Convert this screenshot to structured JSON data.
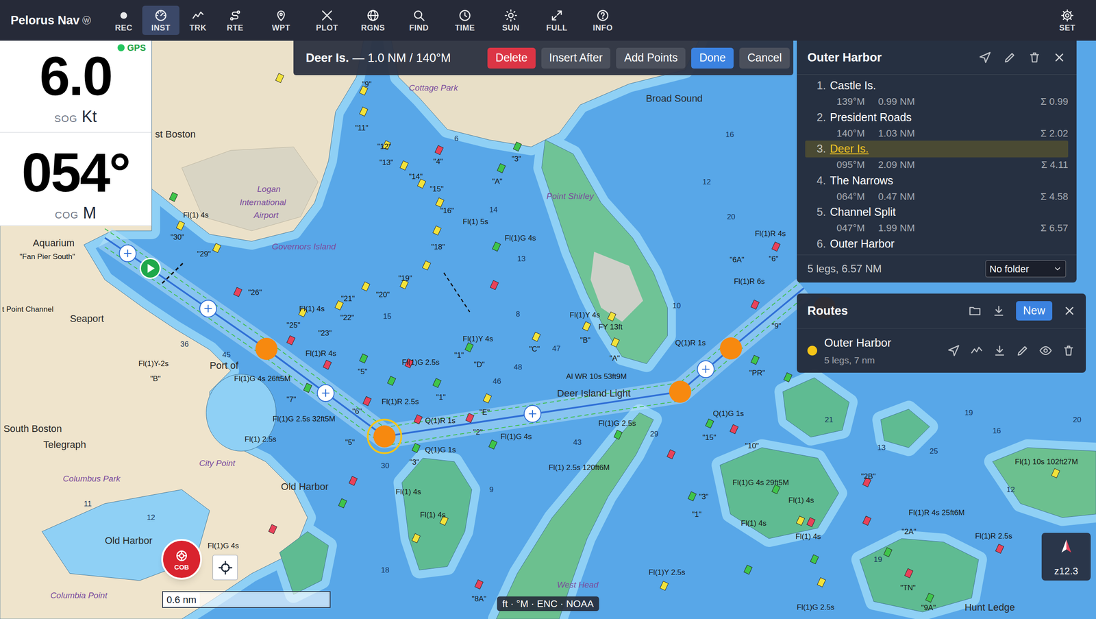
{
  "app": {
    "title": "Pelorus Nav",
    "badge": "ⓦ"
  },
  "toolbar": [
    {
      "label": "REC",
      "selected": false
    },
    {
      "label": "INST",
      "selected": true
    },
    {
      "label": "TRK",
      "selected": false
    },
    {
      "label": "RTE",
      "selected": false
    },
    {
      "label": "WPT",
      "selected": false
    },
    {
      "label": "PLOT",
      "selected": false
    },
    {
      "label": "RGNS",
      "selected": false
    },
    {
      "label": "FIND",
      "selected": false
    },
    {
      "label": "TIME",
      "selected": false
    },
    {
      "label": "SUN",
      "selected": false
    },
    {
      "label": "FULL",
      "selected": false
    },
    {
      "label": "INFO",
      "selected": false
    }
  ],
  "settings": {
    "label": "SET"
  },
  "instruments": {
    "gps": {
      "label": "GPS",
      "on": true
    },
    "readouts": [
      {
        "value": "6.0",
        "label": "SOG",
        "unit": "Kt"
      },
      {
        "value": "054°",
        "label": "COG",
        "unit": "M"
      }
    ]
  },
  "edit_bar": {
    "name": "Deer Is.",
    "detail": "— 1.0 NM / 140°M",
    "buttons": [
      {
        "label": "Delete",
        "kind": "danger"
      },
      {
        "label": "Insert After",
        "kind": "secondary"
      },
      {
        "label": "Add Points",
        "kind": "secondary"
      },
      {
        "label": "Done",
        "kind": "primary"
      },
      {
        "label": "Cancel",
        "kind": "secondary"
      }
    ]
  },
  "route_panel": {
    "title": "Outer Harbor",
    "waypoints": [
      {
        "index": "1.",
        "name": "Castle Is.",
        "bearing": "139°M",
        "distance": "0.99 NM",
        "total": "Σ 0.99",
        "selected": false
      },
      {
        "index": "2.",
        "name": "President Roads",
        "bearing": "140°M",
        "distance": "1.03 NM",
        "total": "Σ 2.02",
        "selected": false
      },
      {
        "index": "3.",
        "name": "Deer Is.",
        "bearing": "095°M",
        "distance": "2.09 NM",
        "total": "Σ 4.11",
        "selected": true
      },
      {
        "index": "4.",
        "name": "The Narrows",
        "bearing": "064°M",
        "distance": "0.47 NM",
        "total": "Σ 4.58",
        "selected": false
      },
      {
        "index": "5.",
        "name": "Channel Split",
        "bearing": "047°M",
        "distance": "1.99 NM",
        "total": "Σ 6.57",
        "selected": false
      },
      {
        "index": "6.",
        "name": "Outer Harbor",
        "selected": false
      }
    ],
    "summary": "5 legs, 6.57 NM",
    "folder": "No folder"
  },
  "routes_panel": {
    "title": "Routes",
    "new_button": "New",
    "routes": [
      {
        "name": "Outer Harbor",
        "detail": "5 legs, 7 nm",
        "color": "#f5c518"
      }
    ]
  },
  "map": {
    "labels": [
      {
        "text": "st Boston",
        "kind": "town"
      },
      {
        "text": "Logan",
        "kind": "place"
      },
      {
        "text": "International",
        "kind": "place"
      },
      {
        "text": "Airport",
        "kind": "place"
      },
      {
        "text": "Cottage Park",
        "kind": "place"
      },
      {
        "text": "Broad Sound",
        "kind": "town"
      },
      {
        "text": "Point Shirley",
        "kind": "place"
      },
      {
        "text": "Governors Island",
        "kind": "place"
      },
      {
        "text": "Deer Island Light",
        "kind": "town"
      },
      {
        "text": "Al WR 10s 53ft9M",
        "kind": "light"
      },
      {
        "text": "Seaport",
        "kind": "town"
      },
      {
        "text": "Port of",
        "kind": "town"
      },
      {
        "text": "South Boston",
        "kind": "town"
      },
      {
        "text": "Telegraph",
        "kind": "town"
      },
      {
        "text": "City Point",
        "kind": "place"
      },
      {
        "text": "Columbus Park",
        "kind": "place"
      },
      {
        "text": "Old Harbor",
        "kind": "town"
      },
      {
        "text": "Old Harbor",
        "kind": "town"
      },
      {
        "text": "Columbia Point",
        "kind": "place"
      },
      {
        "text": "West Head",
        "kind": "place"
      },
      {
        "text": "Hunt Ledge",
        "kind": "town"
      },
      {
        "text": "Aquarium",
        "kind": "town"
      },
      {
        "text": "\"Fan Pier South\"",
        "kind": "light"
      },
      {
        "text": "t Point Channel",
        "kind": "light"
      },
      {
        "text": "Fl(1) 4s",
        "kind": "light"
      },
      {
        "text": "Fl(1)Y-2s",
        "kind": "light"
      },
      {
        "text": "Fl(1)G 4s 26ft5M",
        "kind": "light"
      },
      {
        "text": "Fl(1)R 4s",
        "kind": "light"
      },
      {
        "text": "Fl(1)G 2.5s",
        "kind": "light"
      },
      {
        "text": "Fl(1)R 2.5s",
        "kind": "light"
      },
      {
        "text": "Q(1)R 1s",
        "kind": "light"
      },
      {
        "text": "Q(1)G 1s",
        "kind": "light"
      },
      {
        "text": "Fl(1)G 4s",
        "kind": "light"
      },
      {
        "text": "Fl(1)G 2.5s",
        "kind": "light"
      },
      {
        "text": "Fl(1) 2.5s 120ft6M",
        "kind": "light"
      },
      {
        "text": "Fl(1)Y 4s",
        "kind": "light"
      },
      {
        "text": "FY 13ft",
        "kind": "light"
      },
      {
        "text": "Q(1)R 1s",
        "kind": "light"
      },
      {
        "text": "Q(1)G 1s",
        "kind": "light"
      },
      {
        "text": "Fl(1)G 4s 29ft5M",
        "kind": "light"
      },
      {
        "text": "Fl(1)G 2.5s 32ft5M",
        "kind": "light"
      },
      {
        "text": "Fl(1) 2.5s",
        "kind": "light"
      },
      {
        "text": "Fl(1) 4s",
        "kind": "light"
      },
      {
        "text": "Fl(1) 4s",
        "kind": "light"
      },
      {
        "text": "Fl(1)Y 4s",
        "kind": "light"
      },
      {
        "text": "Fl(1) 5s",
        "kind": "light"
      },
      {
        "text": "Fl(1)G 4s",
        "kind": "light"
      },
      {
        "text": "Fl(1)Y 2.5s",
        "kind": "light"
      },
      {
        "text": "Fl(1) 10s 102ft27M",
        "kind": "light"
      },
      {
        "text": "Fl(1)R 4s 25ft6M",
        "kind": "light"
      },
      {
        "text": "Fl(1)R 2.5s",
        "kind": "light"
      },
      {
        "text": "Fl(1)R 4s",
        "kind": "light"
      },
      {
        "text": "Fl(1)R 6s",
        "kind": "light"
      },
      {
        "text": "Fl(1) 4s",
        "kind": "light"
      },
      {
        "text": "Fl(1)G 4s",
        "kind": "light"
      },
      {
        "text": "Fl(1) 4s",
        "kind": "light"
      },
      {
        "text": "Fl(1) 4s",
        "kind": "light"
      },
      {
        "text": "Fl(1)G 2.5s",
        "kind": "light"
      },
      {
        "text": "Fl(1) 4s",
        "kind": "light"
      },
      {
        "text": "\"26\"",
        "kind": "buoy"
      },
      {
        "text": "\"25\"",
        "kind": "buoy"
      },
      {
        "text": "\"23\"",
        "kind": "buoy"
      },
      {
        "text": "\"21\"",
        "kind": "buoy"
      },
      {
        "text": "\"22\"",
        "kind": "buoy"
      },
      {
        "text": "\"20\"",
        "kind": "buoy"
      },
      {
        "text": "\"19\"",
        "kind": "buoy"
      },
      {
        "text": "\"18\"",
        "kind": "buoy"
      },
      {
        "text": "\"16\"",
        "kind": "buoy"
      },
      {
        "text": "\"15\"",
        "kind": "buoy"
      },
      {
        "text": "\"14\"",
        "kind": "buoy"
      },
      {
        "text": "\"13\"",
        "kind": "buoy"
      },
      {
        "text": "\"12\"",
        "kind": "buoy"
      },
      {
        "text": "\"11\"",
        "kind": "buoy"
      },
      {
        "text": "\"9\"",
        "kind": "buoy"
      },
      {
        "text": "\"5\"",
        "kind": "buoy"
      },
      {
        "text": "\"6\"",
        "kind": "buoy"
      },
      {
        "text": "\"7\"",
        "kind": "buoy"
      },
      {
        "text": "\"5\"",
        "kind": "buoy"
      },
      {
        "text": "\"3\"",
        "kind": "buoy"
      },
      {
        "text": "\"2\"",
        "kind": "buoy"
      },
      {
        "text": "\"E\"",
        "kind": "buoy"
      },
      {
        "text": "\"1\"",
        "kind": "buoy"
      },
      {
        "text": "\"D\"",
        "kind": "buoy"
      },
      {
        "text": "\"1\"",
        "kind": "buoy"
      },
      {
        "text": "\"C\"",
        "kind": "buoy"
      },
      {
        "text": "\"B\"",
        "kind": "buoy"
      },
      {
        "text": "\"A\"",
        "kind": "buoy"
      },
      {
        "text": "\"PR\"",
        "kind": "buoy"
      },
      {
        "text": "\"15\"",
        "kind": "buoy"
      },
      {
        "text": "\"10\"",
        "kind": "buoy"
      },
      {
        "text": "\"6A\"",
        "kind": "buoy"
      },
      {
        "text": "\"6\"",
        "kind": "buoy"
      },
      {
        "text": "\"9\"",
        "kind": "buoy"
      },
      {
        "text": "\"B\"",
        "kind": "buoy"
      },
      {
        "text": "\"30\"",
        "kind": "buoy"
      },
      {
        "text": "\"29\"",
        "kind": "buoy"
      },
      {
        "text": "\"A\"",
        "kind": "buoy"
      },
      {
        "text": "\"3\"",
        "kind": "buoy"
      },
      {
        "text": "\"4\"",
        "kind": "buoy"
      },
      {
        "text": "\"2B\"",
        "kind": "buoy"
      },
      {
        "text": "\"2A\"",
        "kind": "buoy"
      },
      {
        "text": "\"TN\"",
        "kind": "buoy"
      },
      {
        "text": "\"9A\"",
        "kind": "buoy"
      },
      {
        "text": "\"8A\"",
        "kind": "buoy"
      },
      {
        "text": "\"3\"",
        "kind": "buoy"
      },
      {
        "text": "\"1\"",
        "kind": "buoy"
      },
      {
        "text": "36",
        "kind": "sounding"
      },
      {
        "text": "45",
        "kind": "sounding"
      },
      {
        "text": "15",
        "kind": "sounding"
      },
      {
        "text": "6",
        "kind": "sounding"
      },
      {
        "text": "14",
        "kind": "sounding"
      },
      {
        "text": "13",
        "kind": "sounding"
      },
      {
        "text": "8",
        "kind": "sounding"
      },
      {
        "text": "47",
        "kind": "sounding"
      },
      {
        "text": "48",
        "kind": "sounding"
      },
      {
        "text": "46",
        "kind": "sounding"
      },
      {
        "text": "43",
        "kind": "sounding"
      },
      {
        "text": "29",
        "kind": "sounding"
      },
      {
        "text": "16",
        "kind": "sounding"
      },
      {
        "text": "12",
        "kind": "sounding"
      },
      {
        "text": "20",
        "kind": "sounding"
      },
      {
        "text": "10",
        "kind": "sounding"
      },
      {
        "text": "21",
        "kind": "sounding"
      },
      {
        "text": "19",
        "kind": "sounding"
      },
      {
        "text": "16",
        "kind": "sounding"
      },
      {
        "text": "20",
        "kind": "sounding"
      },
      {
        "text": "12",
        "kind": "sounding"
      },
      {
        "text": "13",
        "kind": "sounding"
      },
      {
        "text": "25",
        "kind": "sounding"
      },
      {
        "text": "19",
        "kind": "sounding"
      },
      {
        "text": "11",
        "kind": "sounding"
      },
      {
        "text": "12",
        "kind": "sounding"
      },
      {
        "text": "18",
        "kind": "sounding"
      },
      {
        "text": "9",
        "kind": "sounding"
      },
      {
        "text": "30",
        "kind": "sounding"
      }
    ]
  },
  "cob": {
    "label": "COB"
  },
  "scale": {
    "label": "0.6 nm"
  },
  "attribution": "ft · °M · ENC · NOAA",
  "zoom": {
    "label": "z12.3"
  }
}
